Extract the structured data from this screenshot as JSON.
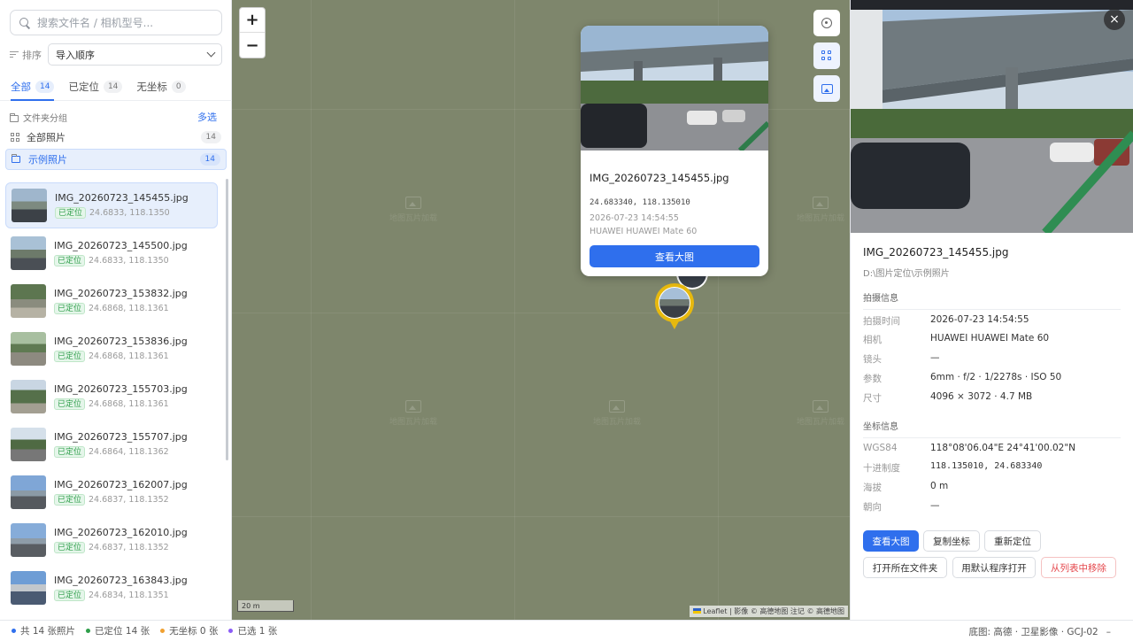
{
  "search": {
    "placeholder": "搜索文件名 / 相机型号..."
  },
  "sort": {
    "label": "排序",
    "value": "导入顺序"
  },
  "tabs": [
    {
      "label": "全部",
      "count": "14"
    },
    {
      "label": "已定位",
      "count": "14"
    },
    {
      "label": "无坐标",
      "count": "0"
    }
  ],
  "groups": {
    "header": "文件夹分组",
    "multiselect": "多选",
    "items": [
      {
        "label": "全部照片",
        "count": "14"
      },
      {
        "label": "示例照片",
        "count": "14"
      }
    ]
  },
  "files": [
    {
      "name": "IMG_20260723_145455.jpg",
      "status": "已定位",
      "coord": "24.6833, 118.1350"
    },
    {
      "name": "IMG_20260723_145500.jpg",
      "status": "已定位",
      "coord": "24.6833, 118.1350"
    },
    {
      "name": "IMG_20260723_153832.jpg",
      "status": "已定位",
      "coord": "24.6868, 118.1361"
    },
    {
      "name": "IMG_20260723_153836.jpg",
      "status": "已定位",
      "coord": "24.6868, 118.1361"
    },
    {
      "name": "IMG_20260723_155703.jpg",
      "status": "已定位",
      "coord": "24.6868, 118.1361"
    },
    {
      "name": "IMG_20260723_155707.jpg",
      "status": "已定位",
      "coord": "24.6864, 118.1362"
    },
    {
      "name": "IMG_20260723_162007.jpg",
      "status": "已定位",
      "coord": "24.6837, 118.1352"
    },
    {
      "name": "IMG_20260723_162010.jpg",
      "status": "已定位",
      "coord": "24.6837, 118.1352"
    },
    {
      "name": "IMG_20260723_163843.jpg",
      "status": "已定位",
      "coord": "24.6834, 118.1351"
    }
  ],
  "map": {
    "zoom_in": "+",
    "zoom_out": "−",
    "tile_placeholder": "地图瓦片加载",
    "scale": "20 m",
    "attribution": {
      "leaflet": "Leaflet",
      "rest": " | 影像 © 高德地图 注记 © 高德地图"
    },
    "popup": {
      "name": "IMG_20260723_145455.jpg",
      "coord": "24.683340, 118.135010",
      "date": "2026-07-23 14:54:55",
      "camera": "HUAWEI HUAWEI Mate 60",
      "button": "查看大图"
    }
  },
  "detail": {
    "close": "×",
    "name": "IMG_20260723_145455.jpg",
    "path": "D:\\图片定位\\示例照片",
    "shoot_section": "拍摄信息",
    "shoot": [
      {
        "k": "拍摄时间",
        "v": "2026-07-23 14:54:55"
      },
      {
        "k": "相机",
        "v": "HUAWEI HUAWEI Mate 60"
      },
      {
        "k": "镜头",
        "v": "—"
      },
      {
        "k": "参数",
        "v": "6mm · f/2 · 1/2278s · ISO 50"
      },
      {
        "k": "尺寸",
        "v": "4096 × 3072 · 4.7 MB"
      }
    ],
    "coord_section": "坐标信息",
    "coords": [
      {
        "k": "WGS84",
        "v": "118°08'06.04\"E 24°41'00.02\"N"
      },
      {
        "k": "十进制度",
        "v": "118.135010, 24.683340"
      },
      {
        "k": "海拔",
        "v": "0 m"
      },
      {
        "k": "朝向",
        "v": "—"
      }
    ],
    "buttons": {
      "view": "查看大图",
      "copy": "复制坐标",
      "relocate": "重新定位",
      "open_folder": "打开所在文件夹",
      "open_default": "用默认程序打开",
      "remove": "从列表中移除"
    }
  },
  "status": {
    "total": "共 14 张照片",
    "located": "已定位 14 张",
    "no_coord": "无坐标 0 张",
    "selected": "已选 1 张",
    "basemap": "底图: 高德 · 卫星影像 · GCJ-02",
    "minimize": "–"
  },
  "colors": {
    "accent": "#2f6fed",
    "located": "#2e9e4a",
    "no_coord": "#f0a030",
    "selected": "#8b5cf6",
    "marker": "#e7b90e"
  }
}
